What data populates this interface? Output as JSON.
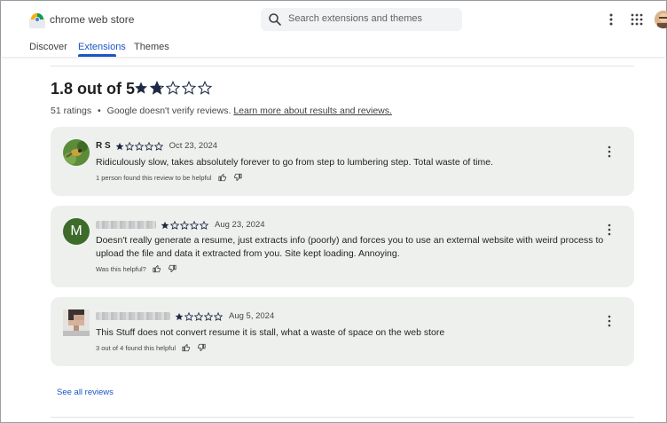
{
  "header": {
    "brand": "chrome web store",
    "search_placeholder": "Search extensions and themes"
  },
  "tabs": [
    {
      "label": "Discover",
      "active": false
    },
    {
      "label": "Extensions",
      "active": true
    },
    {
      "label": "Themes",
      "active": false
    }
  ],
  "summary": {
    "score_text": "1.8 out of 5",
    "score": 1.8,
    "max": 5,
    "ratings_count": "51 ratings",
    "bullet": "•",
    "verify_text": "Google doesn't verify reviews.",
    "learn_more": "Learn more about results and reviews."
  },
  "reviews": [
    {
      "name": "R S",
      "name_blurred": false,
      "stars": 1,
      "date": "Oct 23, 2024",
      "text": "Ridiculously slow, takes absolutely forever to go from step to lumbering step.  Total waste of time.",
      "helpful": "1 person found this review to be helpful"
    },
    {
      "name": "",
      "name_blurred": true,
      "avatar_letter": "M",
      "stars": 1,
      "date": "Aug 23, 2024",
      "text": "Doesn't really generate a resume, just extracts info (poorly) and forces you to use an external website with weird process to upload the file and data it extracted from you. Site kept loading. Annoying.",
      "helpful": "Was this helpful?"
    },
    {
      "name": "",
      "name_blurred": true,
      "stars": 1,
      "date": "Aug 5, 2024",
      "text": "This Stuff does not convert resume it is stall, what a waste of space on the web store",
      "helpful": "3 out of 4 found this helpful"
    }
  ],
  "see_all": "See all reviews",
  "colors": {
    "accent": "#1a56c4",
    "card_bg": "#eef0ee",
    "star": "#1f2a44",
    "avatar_m": "#3d6b2a"
  }
}
